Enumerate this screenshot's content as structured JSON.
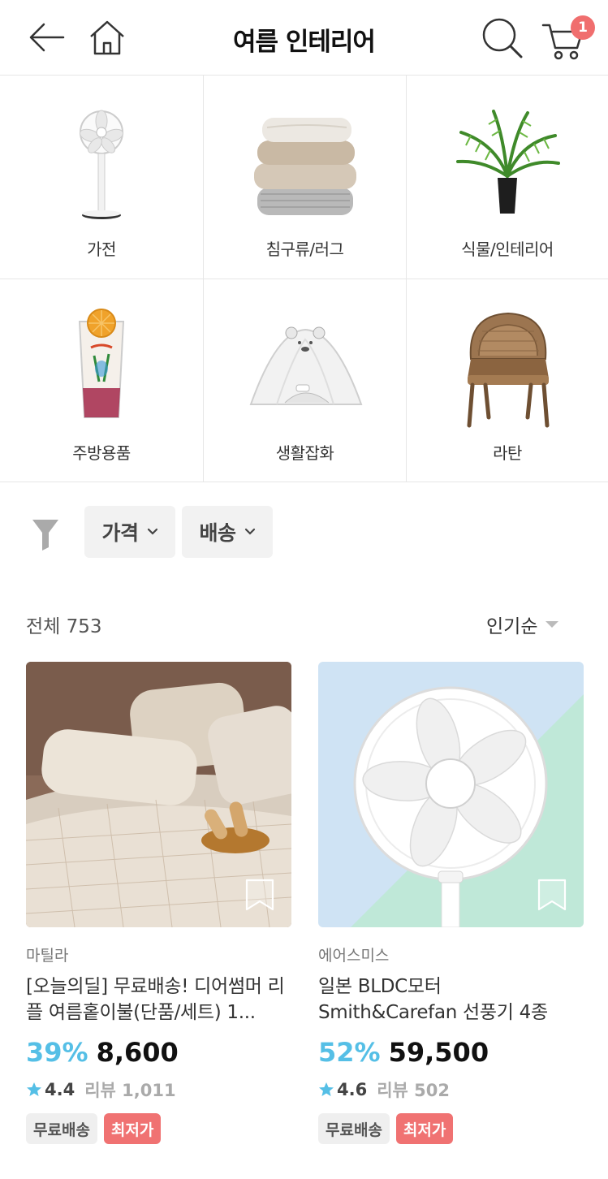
{
  "header": {
    "title": "여름 인테리어",
    "cart_count": "1"
  },
  "categories": [
    {
      "label": "가전",
      "icon": "stand-fan-icon"
    },
    {
      "label": "침구류/러그",
      "icon": "folded-blankets-icon"
    },
    {
      "label": "식물/인테리어",
      "icon": "potted-palm-icon"
    },
    {
      "label": "주방용품",
      "icon": "iced-drink-glass-icon"
    },
    {
      "label": "생활잡화",
      "icon": "mosquito-tent-icon"
    },
    {
      "label": "라탄",
      "icon": "rattan-chair-icon"
    }
  ],
  "filters": {
    "price_label": "가격",
    "shipping_label": "배송"
  },
  "listing": {
    "total": "전체 753",
    "sort": "인기순"
  },
  "products": [
    {
      "brand": "마틸라",
      "name": "[오늘의딜] 무료배송! 디어썸머 리플 여름홑이불(단품/세트) 1...",
      "discount": "39%",
      "price": "8,600",
      "rating": "4.4",
      "reviews": "리뷰 1,011",
      "badge_free": "무료배송",
      "badge_low": "최저가"
    },
    {
      "brand": "에어스미스",
      "name": "일본 BLDC모터 Smith&Carefan 선풍기 4종",
      "discount": "52%",
      "price": "59,500",
      "rating": "4.6",
      "reviews": "리뷰 502",
      "badge_free": "무료배송",
      "badge_low": "최저가"
    }
  ],
  "colors": {
    "accent_blue": "#55bfe6",
    "badge_red": "#f07272",
    "cart_badge": "#f06e6e"
  }
}
